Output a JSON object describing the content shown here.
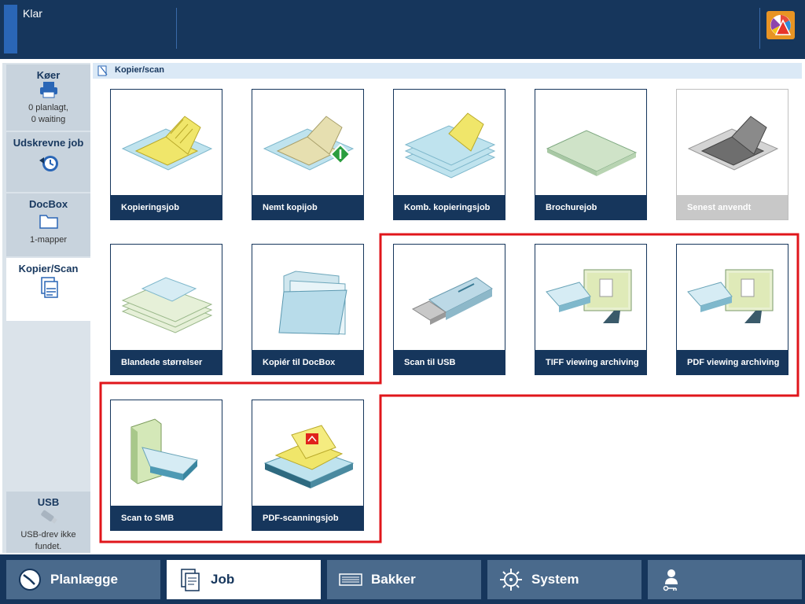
{
  "status": {
    "text": "Klar"
  },
  "sidebar": {
    "items": [
      {
        "title": "Køer",
        "sub1": "0 planlagt,",
        "sub2": "0 waiting"
      },
      {
        "title": "Udskrevne job"
      },
      {
        "title": "DocBox",
        "sub1": "1-mapper"
      },
      {
        "title": "Kopier/Scan"
      },
      {
        "title": "USB",
        "sub1": "USB-drev ikke",
        "sub2": "fundet."
      }
    ]
  },
  "breadcrumb": "Kopier/scan",
  "tiles": [
    {
      "label": "Kopieringsjob"
    },
    {
      "label": "Nemt kopijob"
    },
    {
      "label": "Komb. kopieringsjob"
    },
    {
      "label": "Brochurejob"
    },
    {
      "label": "Senest anvendt"
    },
    {
      "label": "Blandede størrelser"
    },
    {
      "label": "Kopiér til DocBox"
    },
    {
      "label": "Scan til USB"
    },
    {
      "label": "TIFF viewing archiving"
    },
    {
      "label": "PDF viewing archiving"
    },
    {
      "label": "Scan to SMB"
    },
    {
      "label": "PDF-scanningsjob"
    }
  ],
  "nav": [
    {
      "label": "Planlægge"
    },
    {
      "label": "Job"
    },
    {
      "label": "Bakker"
    },
    {
      "label": "System"
    },
    {
      "label": ""
    }
  ],
  "colors": {
    "navy": "#16365c",
    "highlight": "#e0161b",
    "paper": "#f0e66a",
    "glass": "#bfe3ee"
  }
}
